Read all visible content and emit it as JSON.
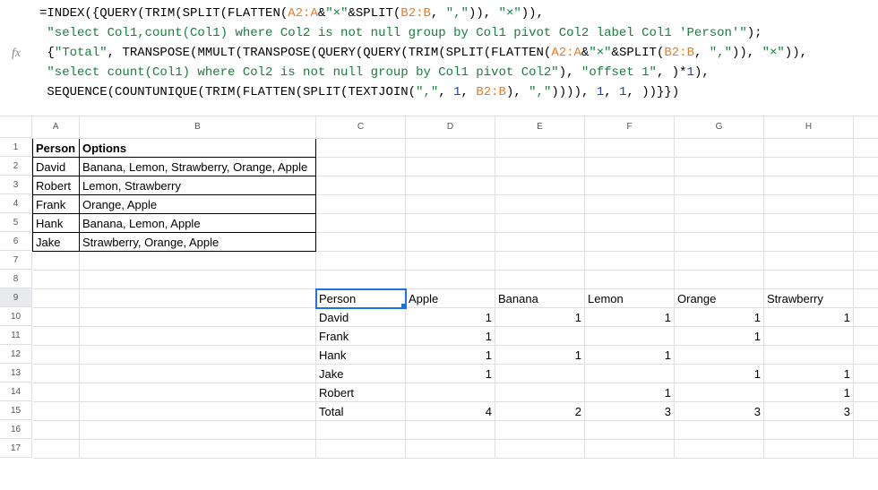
{
  "fx_label": "fx",
  "formula": {
    "l1a": "=INDEX({QUERY(TRIM(SPLIT(FLATTEN(",
    "l1b": "A2:A",
    "l1c": "&",
    "l1d": "\"×\"",
    "l1e": "&SPLIT(",
    "l1f": "B2:B",
    "l1g": ", ",
    "l1h": "\",\"",
    "l1i": ")), ",
    "l1j": "\"×\"",
    "l1k": ")),",
    "l2a": " ",
    "l2b": "\"select Col1,count(Col1) where Col2 is not null group by Col1 pivot Col2 label Col1 'Person'\"",
    "l2c": ");",
    "l3a": " {",
    "l3b": "\"Total\"",
    "l3c": ", TRANSPOSE(MMULT(TRANSPOSE(QUERY(QUERY(TRIM(SPLIT(FLATTEN(",
    "l3d": "A2:A",
    "l3e": "&",
    "l3f": "\"×\"",
    "l3g": "&SPLIT(",
    "l3h": "B2:B",
    "l3i": ", ",
    "l3j": "\",\"",
    "l3k": ")), ",
    "l3l": "\"×\"",
    "l3m": ")),",
    "l4a": " ",
    "l4b": "\"select count(Col1) where Col2 is not null group by Col1 pivot Col2\"",
    "l4c": "), ",
    "l4d": "\"offset 1\"",
    "l4e": ", )*",
    "l4f": "1",
    "l4g": "),",
    "l5a": " SEQUENCE(COUNTUNIQUE(TRIM(FLATTEN(SPLIT(TEXTJOIN(",
    "l5b": "\",\"",
    "l5c": ", ",
    "l5d": "1",
    "l5e": ", ",
    "l5f": "B2:B",
    "l5g": "), ",
    "l5h": "\",\"",
    "l5i": ")))), ",
    "l5j": "1",
    "l5k": ", ",
    "l5l": "1",
    "l5m": ", ))}})"
  },
  "columns": [
    "A",
    "B",
    "C",
    "D",
    "E",
    "F",
    "G",
    "H"
  ],
  "rows": [
    "1",
    "2",
    "3",
    "4",
    "5",
    "6",
    "7",
    "8",
    "9",
    "10",
    "11",
    "12",
    "13",
    "14",
    "15",
    "16",
    "17"
  ],
  "table1": {
    "header_person": "Person",
    "header_options": "Options",
    "rows": [
      {
        "person": "David",
        "options": "Banana, Lemon, Strawberry, Orange, Apple"
      },
      {
        "person": "Robert",
        "options": "Lemon, Strawberry"
      },
      {
        "person": "Frank",
        "options": "Orange, Apple"
      },
      {
        "person": "Hank",
        "options": "Banana, Lemon, Apple"
      },
      {
        "person": "Jake",
        "options": "Strawberry, Orange, Apple"
      }
    ]
  },
  "pivot": {
    "header": [
      "Person",
      "Apple",
      "Banana",
      "Lemon",
      "Orange",
      "Strawberry"
    ],
    "rows": [
      {
        "name": "David",
        "apple": "1",
        "banana": "1",
        "lemon": "1",
        "orange": "1",
        "strawberry": "1"
      },
      {
        "name": "Frank",
        "apple": "1",
        "banana": "",
        "lemon": "",
        "orange": "1",
        "strawberry": ""
      },
      {
        "name": "Hank",
        "apple": "1",
        "banana": "1",
        "lemon": "1",
        "orange": "",
        "strawberry": ""
      },
      {
        "name": "Jake",
        "apple": "1",
        "banana": "",
        "lemon": "",
        "orange": "1",
        "strawberry": "1"
      },
      {
        "name": "Robert",
        "apple": "",
        "banana": "",
        "lemon": "1",
        "orange": "",
        "strawberry": "1"
      },
      {
        "name": "Total",
        "apple": "4",
        "banana": "2",
        "lemon": "3",
        "orange": "3",
        "strawberry": "3"
      }
    ]
  }
}
